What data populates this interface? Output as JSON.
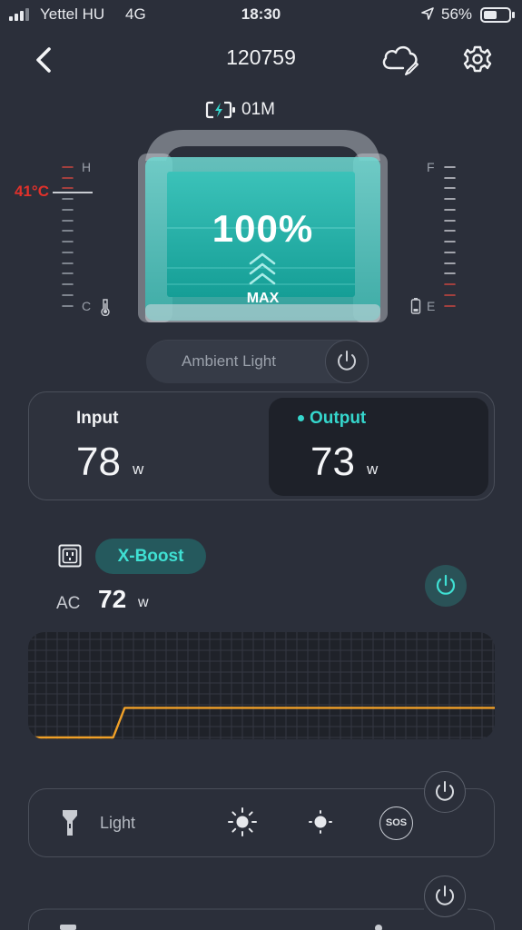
{
  "status_bar": {
    "carrier": "Yettel HU",
    "network": "4G",
    "time": "18:30",
    "battery_percent": "56%"
  },
  "header": {
    "title": "120759",
    "back_icon": "chevron-left-icon",
    "cloud_icon": "cloud-sync-icon",
    "settings_icon": "gear-icon"
  },
  "charge": {
    "time_remaining": "01M",
    "icon": "battery-charging-icon"
  },
  "battery": {
    "level_text": "100%",
    "level": 1.0,
    "mode_text": "MAX",
    "accent_color": "#35d6cc"
  },
  "temperature_gauge": {
    "value_text": "41°C",
    "high_label": "H",
    "low_label": "C",
    "warn_color": "#e0312b",
    "icon": "thermometer-icon"
  },
  "fuel_gauge": {
    "full_label": "F",
    "empty_label": "E",
    "icon": "battery-level-icon"
  },
  "ambient_light": {
    "label": "Ambient Light",
    "power_icon": "power-icon"
  },
  "io": {
    "input_label": "Input",
    "input_value": "78",
    "input_unit": "w",
    "output_label": "Output",
    "output_value": "73",
    "output_unit": "w"
  },
  "ac": {
    "outlet_icon": "ac-outlet-icon",
    "xboost_label": "X-Boost",
    "label": "AC",
    "value": "72",
    "unit": "w",
    "power_icon": "power-icon",
    "accent_color": "#3fe0d3"
  },
  "chart_data": {
    "type": "line",
    "title": "",
    "xlabel": "",
    "ylabel": "",
    "series": [
      {
        "values": [
          0,
          0,
          0,
          0,
          0,
          0,
          72,
          72,
          72,
          72,
          72,
          72,
          72,
          72,
          72,
          72,
          72,
          72,
          72,
          72,
          72,
          72,
          72,
          72,
          72,
          72,
          72,
          72,
          72,
          72
        ]
      }
    ],
    "ylim": [
      0,
      300
    ],
    "grid": true,
    "line_color": "#f0a028"
  },
  "light": {
    "label": "Light",
    "flashlight_icon": "flashlight-icon",
    "bright_icon": "sun-bright-icon",
    "dim_icon": "sun-dim-icon",
    "sos_label": "SOS",
    "power_icon": "power-icon"
  },
  "next_section": {
    "power_icon": "power-icon"
  }
}
